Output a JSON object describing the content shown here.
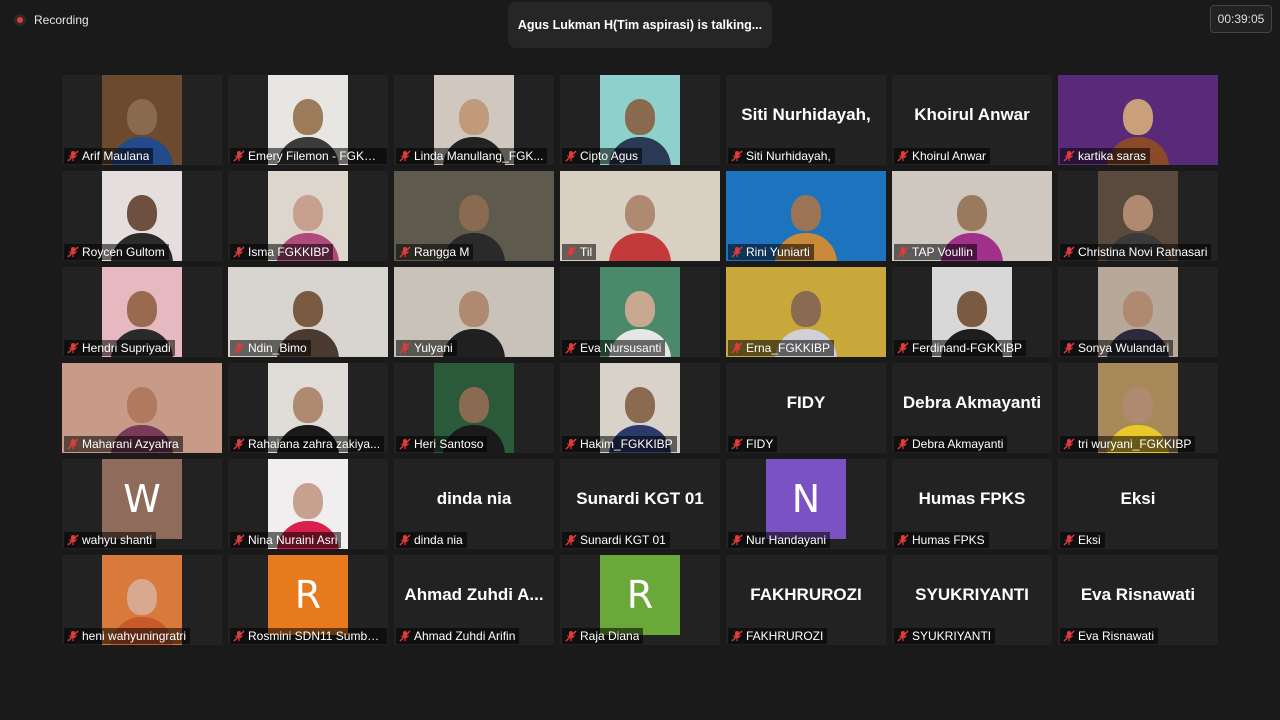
{
  "recording": {
    "label": "Recording"
  },
  "speaker": {
    "text": "Agus Lukman H(Tim aspirasi) is talking..."
  },
  "timer": {
    "value": "00:39:05"
  },
  "participants": [
    {
      "label": "Arif Maulana",
      "kind": "video",
      "bg": "#6b4a2e",
      "skin": "#8a6a4e",
      "shirt": "#234a8a"
    },
    {
      "label": "Emery Filemon - FGKKI...",
      "kind": "video",
      "bg": "#e8e6e2",
      "skin": "#9c7a5a",
      "shirt": "#3b3b3b"
    },
    {
      "label": "Linda Manullang_FGK...",
      "kind": "video",
      "bg": "#d0c8bf",
      "skin": "#c09a7a",
      "shirt": "#222222"
    },
    {
      "label": "Cipto Agus",
      "kind": "video",
      "bg": "#8ed0cc",
      "skin": "#8a6a4e",
      "shirt": "#2a3a55"
    },
    {
      "label": "Siti Nurhidayah,",
      "kind": "name",
      "display": "Siti Nurhidayah,"
    },
    {
      "label": "Khoirul Anwar",
      "kind": "name",
      "display": "Khoirul Anwar"
    },
    {
      "label": "kartika saras",
      "kind": "video",
      "bg": "#5a2a7a",
      "skin": "#c9a07a",
      "shirt": "#8a4a2a",
      "wide": true
    },
    {
      "label": "Roycen Gultom",
      "kind": "video",
      "bg": "#e4dede",
      "skin": "#6e5040",
      "shirt": "#2b2b2b"
    },
    {
      "label": "Isma FGKKIBP",
      "kind": "video",
      "bg": "#ddd6cc",
      "skin": "#c8a090",
      "shirt": "#b04a7a"
    },
    {
      "label": "Rangga M",
      "kind": "video",
      "bg": "#5e5a4e",
      "skin": "#8a6a50",
      "shirt": "#2a2a2a",
      "wide": true
    },
    {
      "label": "Til",
      "kind": "video",
      "bg": "#d9cfc2",
      "skin": "#b08a70",
      "shirt": "#c23a3a",
      "wide": true
    },
    {
      "label": "Rini Yuniarti",
      "kind": "video",
      "bg": "#1e73be",
      "skin": "#9a7454",
      "shirt": "#c98a3a",
      "wide": true
    },
    {
      "label": "TAP Voullin",
      "kind": "video",
      "bg": "#cfc8c0",
      "skin": "#9a7a5e",
      "shirt": "#a0308a",
      "wide": true
    },
    {
      "label": "Christina Novi Ratnasari",
      "kind": "video",
      "bg": "#5a4a3e",
      "skin": "#b08a70",
      "shirt": "#3a3a3a"
    },
    {
      "label": "Hendri Supriyadi",
      "kind": "video",
      "bg": "#e6b8c0",
      "skin": "#9a6a50",
      "shirt": "#2a2a2a"
    },
    {
      "label": "Ndin_Bimo",
      "kind": "video",
      "bg": "#d8d4cf",
      "skin": "#7a5a40",
      "shirt": "#4a3a30",
      "wide": true
    },
    {
      "label": "Yulyani",
      "kind": "video",
      "bg": "#c8c2b8",
      "skin": "#b08a70",
      "shirt": "#202020",
      "wide": true
    },
    {
      "label": "Eva Nursusanti",
      "kind": "video",
      "bg": "#4a8a6a",
      "skin": "#c8a890",
      "shirt": "#e6e6e6"
    },
    {
      "label": "Erna_FGKKIBP",
      "kind": "video",
      "bg": "#c8a83a",
      "skin": "#8a6a50",
      "shirt": "#d0d0d8",
      "wide": true
    },
    {
      "label": "Ferdinand-FGKKIBP",
      "kind": "video",
      "bg": "#d8d8d8",
      "skin": "#7a5a40",
      "shirt": "#1e1e1e"
    },
    {
      "label": "Sonya Wulandari",
      "kind": "video",
      "bg": "#b8a89a",
      "skin": "#b08a70",
      "shirt": "#2a2a3a"
    },
    {
      "label": "Maharani Azyahra",
      "kind": "video",
      "bg": "#c89a88",
      "skin": "#b07a60",
      "shirt": "#7a3a5a",
      "wide": true
    },
    {
      "label": "Rahaiana zahra zakiya...",
      "kind": "video",
      "bg": "#e0dcd8",
      "skin": "#b08a70",
      "shirt": "#1a1a1a"
    },
    {
      "label": "Heri Santoso",
      "kind": "video",
      "bg": "#2a5a3a",
      "skin": "#8a6a50",
      "shirt": "#1a1a1a"
    },
    {
      "label": "Hakim_FGKKIBP",
      "kind": "video",
      "bg": "#d8d2c8",
      "skin": "#8a6a50",
      "shirt": "#2a3a6a"
    },
    {
      "label": "FIDY",
      "kind": "name",
      "display": "FIDY"
    },
    {
      "label": "Debra Akmayanti",
      "kind": "name",
      "display": "Debra Akmayanti"
    },
    {
      "label": "tri wuryani_FGKKIBP",
      "kind": "video",
      "bg": "#a88a5a",
      "skin": "#b08a70",
      "shirt": "#e8c82a"
    },
    {
      "label": "wahyu shanti",
      "kind": "avatar",
      "letter": "W",
      "color": "#8e6b5a"
    },
    {
      "label": "Nina Nuraini Asri",
      "kind": "video",
      "bg": "#f0eeee",
      "skin": "#c8a090",
      "shirt": "#d8204a"
    },
    {
      "label": "dinda nia",
      "kind": "name",
      "display": "dinda nia"
    },
    {
      "label": "Sunardi KGT 01",
      "kind": "name",
      "display": "Sunardi KGT 01"
    },
    {
      "label": "Nur Handayani",
      "kind": "avatar",
      "letter": "N",
      "color": "#7b52c4"
    },
    {
      "label": "Humas FPKS",
      "kind": "name",
      "display": "Humas FPKS"
    },
    {
      "label": "Eksi",
      "kind": "name",
      "display": "Eksi"
    },
    {
      "label": "heni wahyuningratri",
      "kind": "video",
      "bg": "#d87a3a",
      "skin": "#d8a890",
      "shirt": "#c85a2a"
    },
    {
      "label": "Rosmini SDN11 Sumba...",
      "kind": "avatar",
      "letter": "R",
      "color": "#e87a1e"
    },
    {
      "label": "Ahmad Zuhdi Arifin",
      "kind": "name",
      "display": "Ahmad Zuhdi A..."
    },
    {
      "label": "Raja Diana",
      "kind": "avatar",
      "letter": "R",
      "color": "#6aa83a"
    },
    {
      "label": "FAKHRUROZI",
      "kind": "name",
      "display": "FAKHRUROZI"
    },
    {
      "label": "SYUKRIYANTI",
      "kind": "name",
      "display": "SYUKRIYANTI"
    },
    {
      "label": "Eva Risnawati",
      "kind": "name",
      "display": "Eva Risnawati"
    }
  ]
}
